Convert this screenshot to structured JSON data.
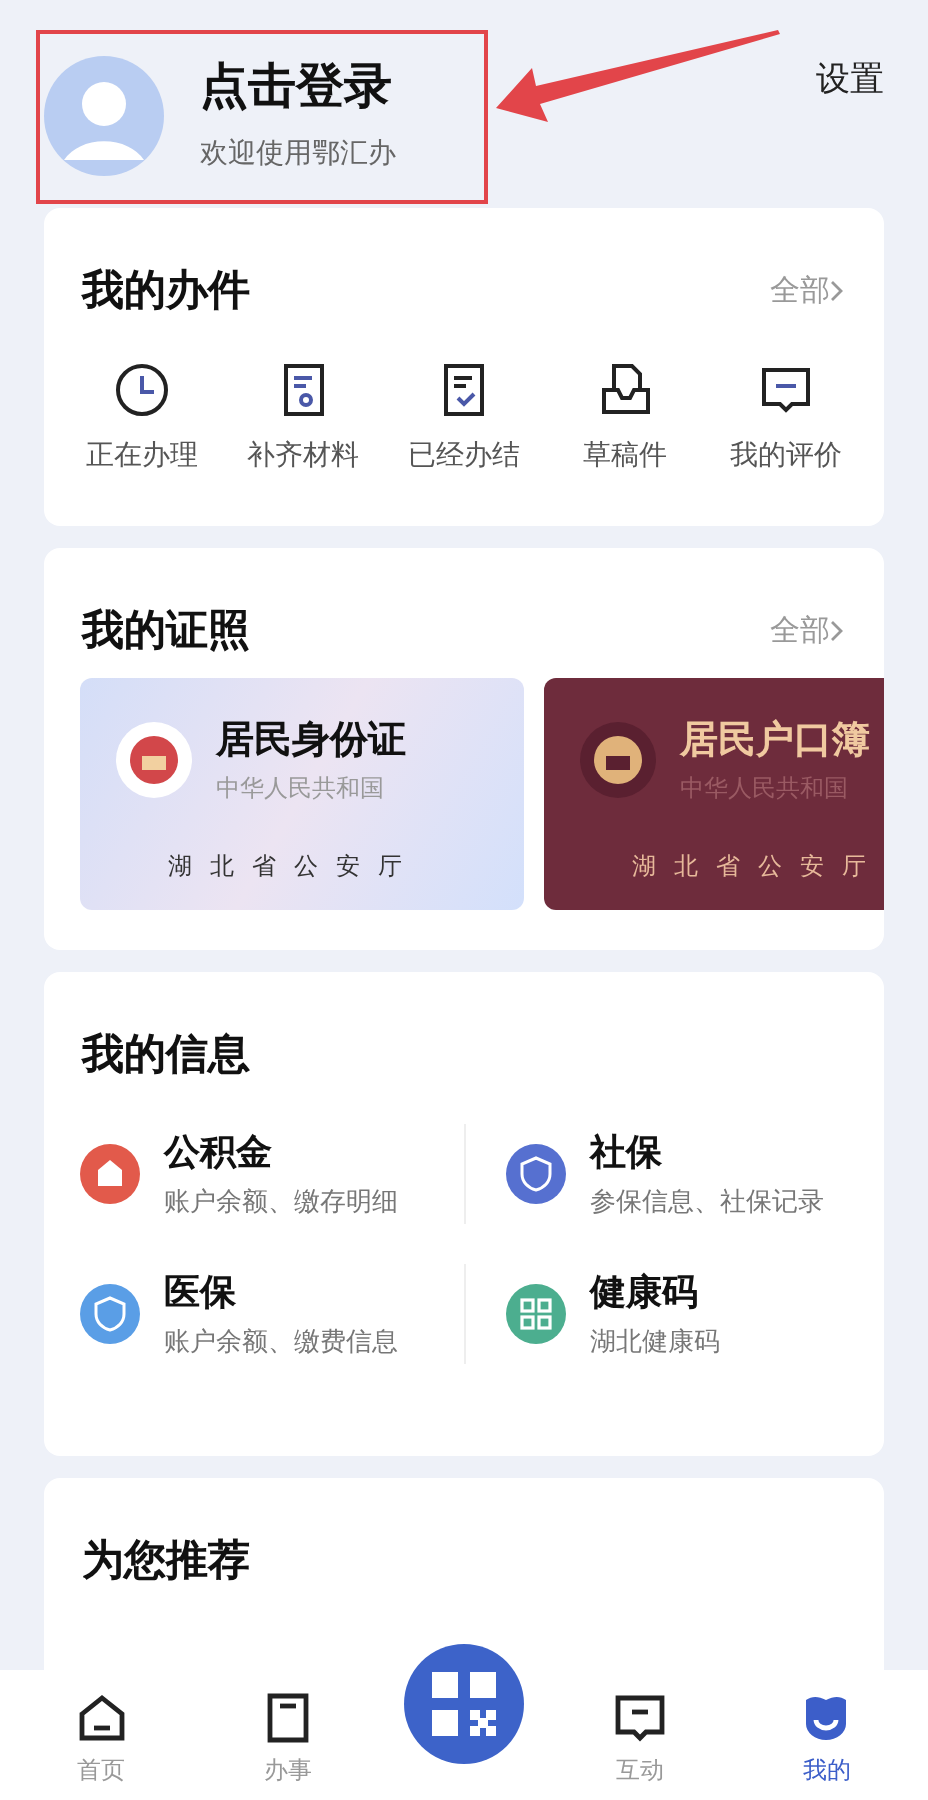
{
  "header": {
    "title": "点击登录",
    "subtitle": "欢迎使用鄂汇办",
    "settings": "设置",
    "highlighted": true
  },
  "cases": {
    "title": "我的办件",
    "more": "全部",
    "items": [
      {
        "kind": "clock",
        "label": "正在办理"
      },
      {
        "kind": "doc",
        "label": "补齐材料"
      },
      {
        "kind": "check",
        "label": "已经办结"
      },
      {
        "kind": "tray",
        "label": "草稿件"
      },
      {
        "kind": "comment",
        "label": "我的评价"
      }
    ]
  },
  "licenses": {
    "title": "我的证照",
    "more": "全部",
    "items": [
      {
        "kind": "light",
        "title": "居民身份证",
        "country": "中华人民共和国",
        "issuer": "湖北省公安厅"
      },
      {
        "kind": "dark",
        "title": "居民户口簿",
        "country": "中华人民共和国",
        "issuer": "湖北省公安厅"
      }
    ]
  },
  "info": {
    "title": "我的信息",
    "items": [
      {
        "kind": "house",
        "title": "公积金",
        "desc": "账户余额、缴存明细",
        "color": "#e25a4b"
      },
      {
        "kind": "shield",
        "title": "社保",
        "desc": "参保信息、社保记录",
        "color": "#5670d0"
      },
      {
        "kind": "shield",
        "title": "医保",
        "desc": "账户余额、缴费信息",
        "color": "#5a9ee6"
      },
      {
        "kind": "qr",
        "title": "健康码",
        "desc": "湖北健康码",
        "color": "#4cae8f"
      }
    ]
  },
  "recommend": {
    "title": "为您推荐"
  },
  "tabbar": {
    "items": [
      {
        "kind": "home",
        "label": "首页",
        "selected": false
      },
      {
        "kind": "task",
        "label": "办事",
        "selected": false
      },
      {
        "kind": "scan",
        "selected": false
      },
      {
        "kind": "chat",
        "label": "互动",
        "selected": false
      },
      {
        "kind": "me",
        "label": "我的",
        "selected": true
      }
    ]
  }
}
